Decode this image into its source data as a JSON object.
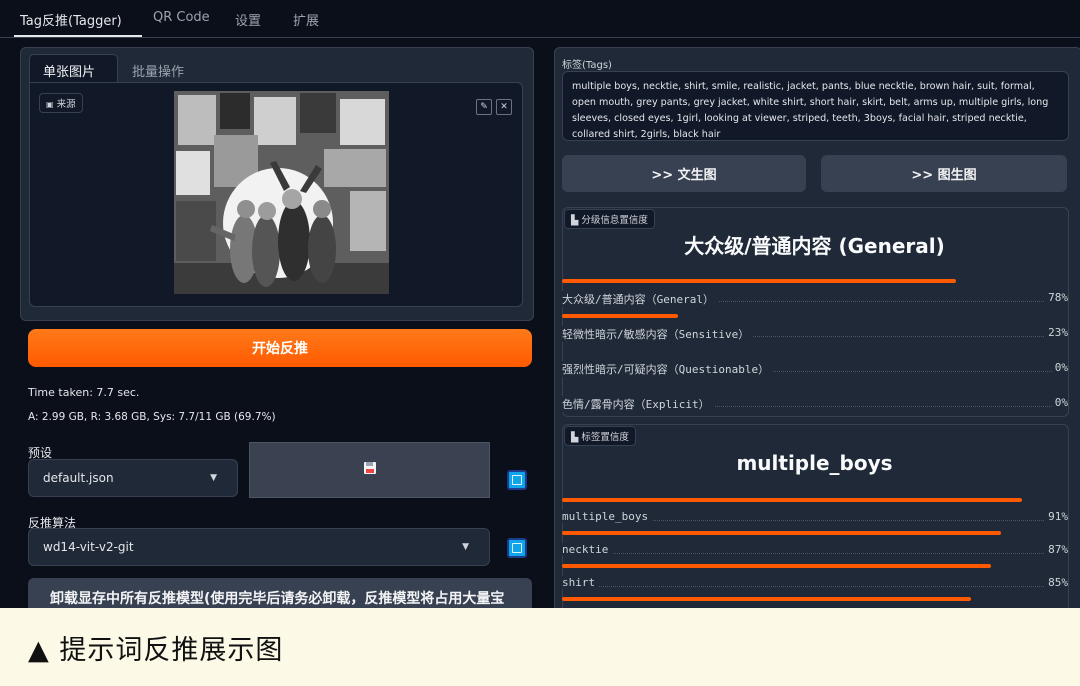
{
  "top_tabs": [
    "Tag反推(Tagger)",
    "QR Code",
    "设置",
    "扩展"
  ],
  "left": {
    "sub_tabs": [
      "单张图片",
      "批量操作"
    ],
    "source_label": "来源",
    "interrogate_button": "开始反推",
    "time_taken": "Time taken: 7.7 sec.",
    "memory": "A: 2.99 GB, R: 3.68 GB, Sys: 7.7/11 GB (69.7%)",
    "preset_label": "预设",
    "preset_value": "default.json",
    "algo_label": "反推算法",
    "algo_value": "wd14-vit-v2-git",
    "unload_button": "卸载显存中所有反推模型(使用完毕后请务必卸载，反推模型将占用大量宝"
  },
  "right": {
    "tags_label": "标签(Tags)",
    "tags_text": "multiple boys, necktie, shirt, smile, realistic, jacket, pants, blue necktie, brown hair, suit, formal, open mouth, grey pants, grey jacket, white shirt, short hair, skirt, belt, arms up, multiple girls, long sleeves, closed eyes, 1girl, looking at viewer, striped, teeth, 3boys, facial hair, striped necktie, collared shirt, 2girls, black hair",
    "to_txt2img": ">> 文生图",
    "to_img2img": ">> 图生图",
    "rating_label": "分级信息置信度",
    "rating_title": "大众级/普通内容 (General)",
    "ratings": [
      {
        "name": "大众级/普通内容（General）",
        "pct": "78%",
        "value": 0.78
      },
      {
        "name": "轻微性暗示/敏感内容（Sensitive）",
        "pct": "23%",
        "value": 0.23
      },
      {
        "name": "强烈性暗示/可疑内容（Questionable）",
        "pct": "0%",
        "value": 0.0
      },
      {
        "name": "色情/露骨内容（Explicit）",
        "pct": "0%",
        "value": 0.0
      }
    ],
    "tag_conf_label": "标签置信度",
    "tag_title": "multiple_boys",
    "tag_confs": [
      {
        "name": "multiple_boys",
        "pct": "91%",
        "value": 0.91
      },
      {
        "name": "necktie",
        "pct": "87%",
        "value": 0.87
      },
      {
        "name": "shirt",
        "pct": "85%",
        "value": 0.85
      },
      {
        "name": "",
        "pct": "",
        "value": 0.81
      }
    ]
  },
  "caption": "▲ 提示词反推展示图",
  "colors": {
    "accent": "#ff5a00",
    "bg": "#0b0f19",
    "panel": "#1f2937",
    "caption_bg": "#fcf9e6"
  }
}
